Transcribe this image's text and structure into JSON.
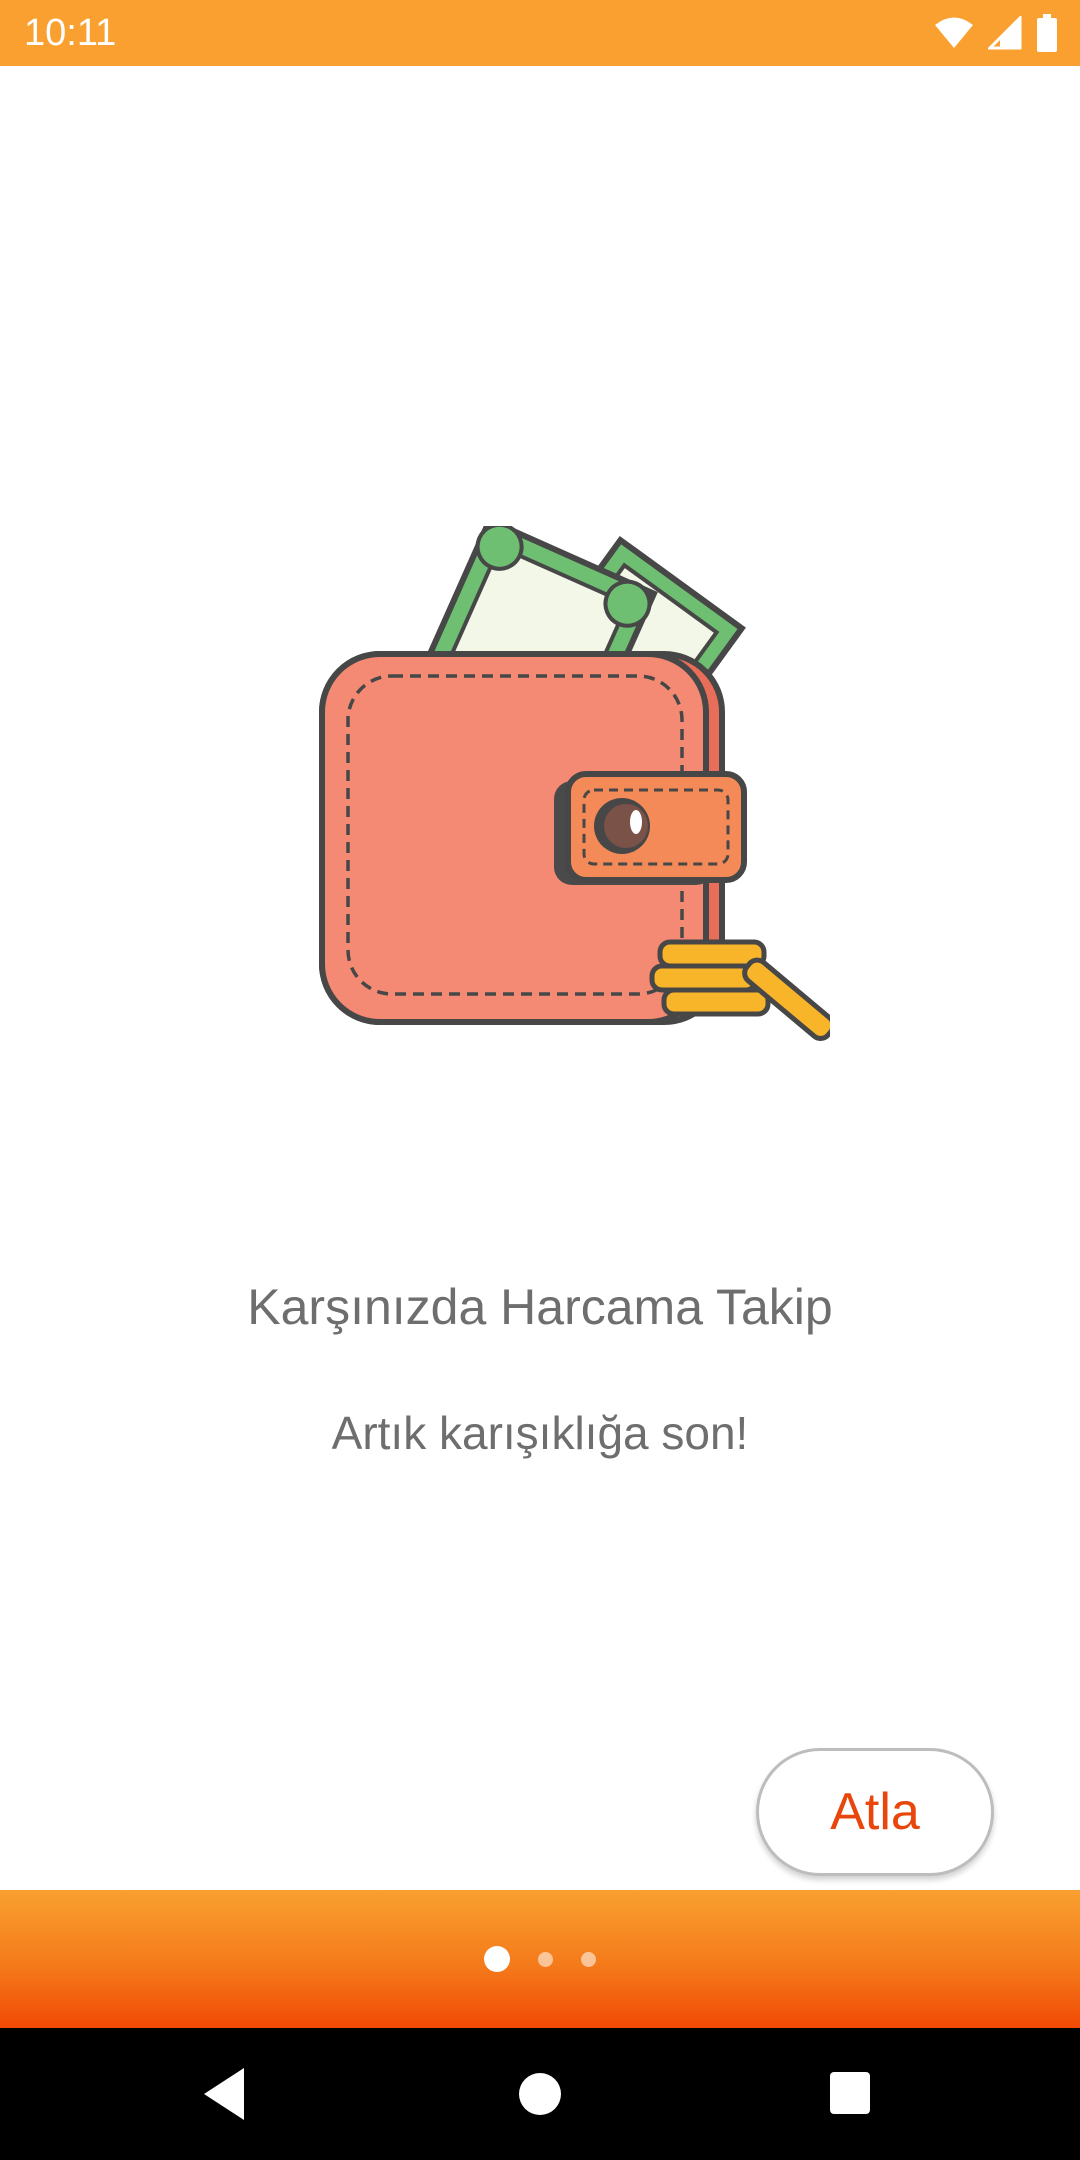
{
  "status_bar": {
    "time": "10:11",
    "background_color": "#F9A030",
    "icons": [
      "wifi-icon",
      "cellular-signal-icon",
      "battery-icon"
    ]
  },
  "onboarding": {
    "illustration": "wallet-with-money-and-coins",
    "title": "Karşınızda Harcama Takip",
    "subtitle": "Artık karışıklığa son!",
    "skip_label": "Atla",
    "accent_color": "#E8460A",
    "page_indicator": {
      "total": 3,
      "current": 1
    }
  },
  "nav_bar": {
    "buttons": [
      "back-icon",
      "home-icon",
      "recents-icon"
    ]
  }
}
